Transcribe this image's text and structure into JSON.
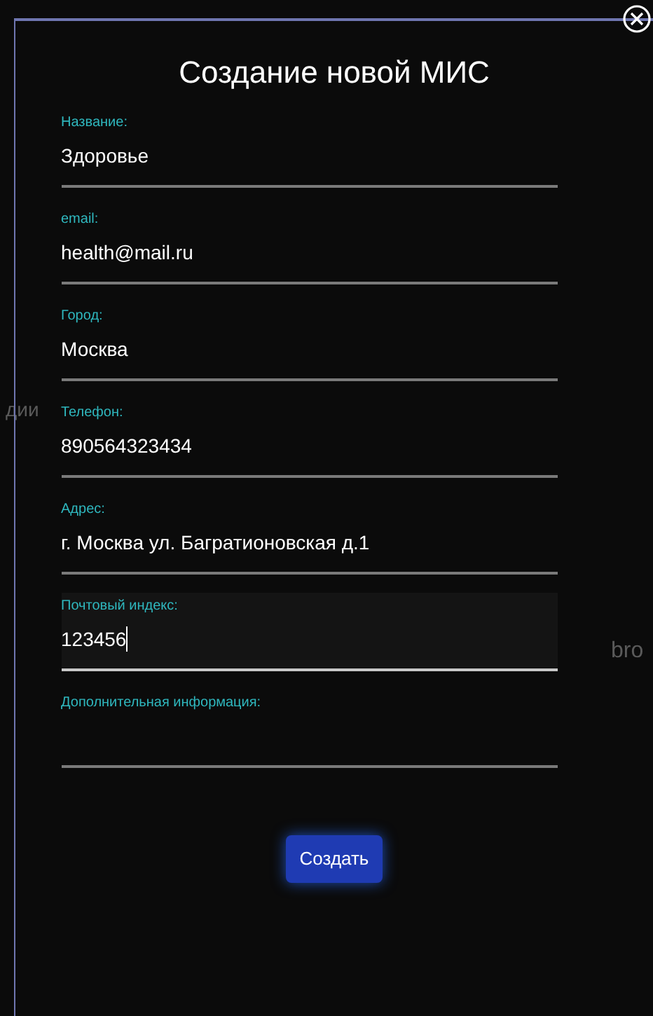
{
  "background": {
    "side_text": "дии",
    "right_text": "bro"
  },
  "dialog": {
    "title": "Создание новой МИС",
    "fields": [
      {
        "label": "Название:",
        "value": "Здоровье",
        "focused": false
      },
      {
        "label": "email:",
        "value": "health@mail.ru",
        "focused": false
      },
      {
        "label": "Город:",
        "value": "Москва",
        "focused": false
      },
      {
        "label": "Телефон:",
        "value": "890564323434",
        "focused": false
      },
      {
        "label": "Адрес:",
        "value": "г. Москва ул. Багратионовская д.1",
        "focused": false
      },
      {
        "label": "Почтовый индекс:",
        "value": "123456",
        "focused": true
      },
      {
        "label": "Дополнительная информация:",
        "focused": false
      }
    ],
    "submit": "Создать"
  }
}
